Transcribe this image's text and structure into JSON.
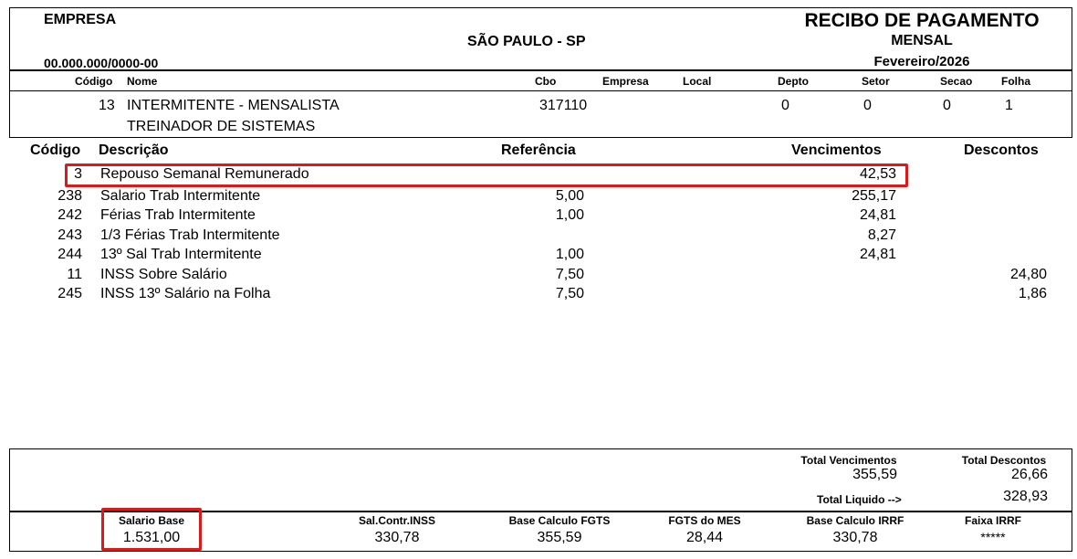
{
  "header": {
    "company_label": "EMPRESA",
    "city": "SÃO PAULO - SP",
    "cnpj": "00.000.000/0000-00",
    "title": "RECIBO DE PAGAMENTO",
    "subtitle": "MENSAL",
    "period": "Fevereiro/2026"
  },
  "employee_columns": {
    "codigo": "Código",
    "nome": "Nome",
    "cbo": "Cbo",
    "empresa": "Empresa",
    "local": "Local",
    "depto": "Depto",
    "setor": "Setor",
    "secao": "Secao",
    "folha": "Folha"
  },
  "employee": {
    "codigo": "13",
    "nome": "INTERMITENTE - MENSALISTA",
    "cargo": "TREINADOR DE SISTEMAS",
    "cbo": "317110",
    "depto": "0",
    "setor": "0",
    "secao": "0",
    "folha": "1"
  },
  "items_columns": {
    "codigo": "Código",
    "descricao": "Descrição",
    "referencia": "Referência",
    "vencimentos": "Vencimentos",
    "descontos": "Descontos"
  },
  "items": [
    {
      "codigo": "3",
      "descricao": "Repouso Semanal Remunerado",
      "referencia": "",
      "vencimentos": "42,53",
      "descontos": ""
    },
    {
      "codigo": "238",
      "descricao": "Salario Trab Intermitente",
      "referencia": "5,00",
      "vencimentos": "255,17",
      "descontos": ""
    },
    {
      "codigo": "242",
      "descricao": "Férias Trab Intermitente",
      "referencia": "1,00",
      "vencimentos": "24,81",
      "descontos": ""
    },
    {
      "codigo": "243",
      "descricao": "1/3 Férias Trab Intermitente",
      "referencia": "",
      "vencimentos": "8,27",
      "descontos": ""
    },
    {
      "codigo": "244",
      "descricao": "13º Sal Trab Intermitente",
      "referencia": "1,00",
      "vencimentos": "24,81",
      "descontos": ""
    },
    {
      "codigo": "11",
      "descricao": "INSS Sobre Salário",
      "referencia": "7,50",
      "vencimentos": "",
      "descontos": "24,80"
    },
    {
      "codigo": "245",
      "descricao": "INSS 13º Salário na Folha",
      "referencia": "7,50",
      "vencimentos": "",
      "descontos": "1,86"
    }
  ],
  "totals": {
    "total_vencimentos_label": "Total Vencimentos",
    "total_vencimentos": "355,59",
    "total_descontos_label": "Total Descontos",
    "total_descontos": "26,66",
    "total_liquido_label": "Total Liquido -->",
    "total_liquido": "328,93"
  },
  "footer": {
    "salario_base_label": "Salario Base",
    "salario_base": "1.531,00",
    "sal_contr_inss_label": "Sal.Contr.INSS",
    "sal_contr_inss": "330,78",
    "base_fgts_label": "Base Calculo FGTS",
    "base_fgts": "355,59",
    "fgts_mes_label": "FGTS do MES",
    "fgts_mes": "28,44",
    "base_irrf_label": "Base Calculo IRRF",
    "base_irrf": "330,78",
    "faixa_irrf_label": "Faixa IRRF",
    "faixa_irrf": "*****"
  },
  "colors": {
    "highlight": "#e01818",
    "text": "#000000",
    "background": "#ffffff"
  }
}
